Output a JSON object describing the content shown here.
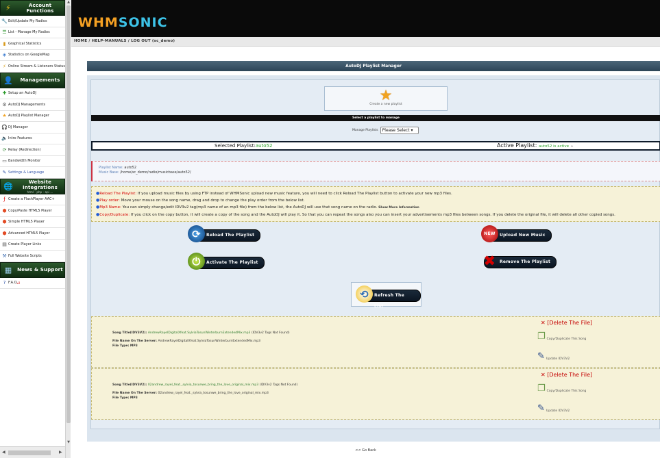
{
  "sidebar": {
    "sections": [
      {
        "title": "Account Functions",
        "icon": "lightning-icon",
        "items": [
          {
            "label": "Edit/Update My Radios",
            "icon": "wrench-icon"
          },
          {
            "label": "List - Manage My Radios",
            "icon": "list-icon"
          },
          {
            "label": "Graphical Statistics",
            "icon": "chart-icon"
          },
          {
            "label": "Statistics on GoogleMap",
            "icon": "map-icon"
          },
          {
            "label": "Online Stream & Listeners Status",
            "icon": "signal-icon"
          }
        ]
      },
      {
        "title": "Managements",
        "icon": "person-icon",
        "items": [
          {
            "label": "Setup an AutoDJ",
            "icon": "plus-icon"
          },
          {
            "label": "AutoDJ Managements",
            "icon": "gear-icon"
          },
          {
            "label": "AutoDJ Playlist Manager",
            "icon": "star-icon"
          },
          {
            "label": "DJ Manager",
            "icon": "headphones-icon"
          },
          {
            "label": "Intro Features",
            "icon": "speaker-icon"
          },
          {
            "label": "Relay (Redirection)",
            "icon": "relay-icon"
          },
          {
            "label": "Bandwidth Monitor",
            "icon": "monitor-icon"
          },
          {
            "label": "Settings & Language",
            "icon": "settings-icon"
          }
        ]
      },
      {
        "title": "Website Integrations",
        "subtitle": "html - php - api ...",
        "icon": "globe-icon",
        "items": [
          {
            "label": "Create a FlashPlayer AAC+",
            "icon": "flash-icon"
          },
          {
            "label": "Copy/Paste HTML5 Player",
            "icon": "html5-icon"
          },
          {
            "label": "Simple HTML5 Player",
            "icon": "html5-icon"
          },
          {
            "label": "Advanced HTML5 Player",
            "icon": "html5-icon"
          },
          {
            "label": "Create Player Links",
            "icon": "link-icon"
          },
          {
            "label": "Full Website Scripts",
            "icon": "script-icon"
          }
        ]
      },
      {
        "title": "News & Support",
        "icon": "newspaper-icon",
        "items": [
          {
            "label": "F.A.Q",
            "badge": "v2",
            "icon": "faq-icon"
          }
        ]
      }
    ]
  },
  "header": {
    "logo_part1": "WHM",
    "logo_part2": "SONIC",
    "breadcrumb": [
      "HOME",
      "HELP-MANUALS",
      "LOG OUT (sc_demo)"
    ]
  },
  "manager": {
    "title": "AutoDJ Playlist Manager",
    "create_label": "Create a new playlist",
    "select_bar": "Select a playlist to manage",
    "manage_label": "Manage Playlists",
    "select_value": "Please Select",
    "selected_label": "Selected Playlist:",
    "selected_value": "auto52",
    "active_label": "Active Playlist:",
    "active_value": "auto52 is active",
    "playlist_name_label": "Playlist Name:",
    "playlist_name": "auto52",
    "music_base_label": "Music Base:",
    "music_base": "/home/sc_demo/radio/musicbase/auto52/"
  },
  "tips": [
    {
      "key": "Reload The Playlist:",
      "text": " If you upload music files by using FTP instead of WHMSonic upload new music feature, you will need to click Reload The Playlist button to activate your new mp3 files.",
      "bold": false
    },
    {
      "key": "Play order:",
      "text": " Move your mouse on the song name, drag and drop to change the play order from the below list.",
      "bold": false
    },
    {
      "key": "Mp3 Name:",
      "text": " You can simply change/edit IDV3v2 tag(mp3 name of an mp3 file) from the below list, the AutoDJ will use that song name on the radio.",
      "extra": "Show More Information",
      "bold": false
    },
    {
      "key": "Copy/Duplicate:",
      "text": " If you click on the copy button, it will create a copy of the song and the AutoDJ will play it. So that you can repeat the songs also you can insert your advertisements mp3 files between songs. If you delete the original file, it will delete all other copied songs.",
      "bold": false
    }
  ],
  "buttons": {
    "reload": "Reload The Playlist",
    "activate": "Activate The Playlist",
    "upload": "Upload New Music",
    "upload_badge": "NEW",
    "remove": "Remove The Playlist",
    "refresh": "Refresh The List"
  },
  "songs": [
    {
      "title_label": "Song Title(IDV3V2):",
      "title": "AndrewRayelDigitalXfeat.SylviaTosunWinterburnExtendedMix.mp3",
      "tag_note": "(IDV3v2 Tags Not Found)",
      "file_label": "File Name On The Server:",
      "file": "AndrewRayelDigitalXfeat.SylviaTosunWinterburnExtendedMix.mp3",
      "type_label": "File Type:",
      "type": "MP3",
      "delete": "[Delete The File]",
      "copy": "Copy/Duplicate This Song",
      "update": "Update IDV3V2"
    },
    {
      "title_label": "Song Title(IDV3V2):",
      "title": "02andrew_rayel_feat._sylvia_tosunwe_bring_the_love_original_mix.mp3",
      "tag_note": "(IDV3v2 Tags Not Found)",
      "file_label": "File Name On The Server:",
      "file": "02andrew_rayel_feat._sylvia_tosunwe_bring_the_love_original_mix.mp3",
      "type_label": "File Type:",
      "type": "MP3",
      "delete": "[Delete The File]",
      "copy": "Copy/Duplicate This Song",
      "update": "Update IDV3V2"
    }
  ],
  "footer": {
    "go_back": "<< Go Back"
  },
  "colors": {
    "active_green": "#2ca32c",
    "tip_red": "#d40000",
    "logo_orange": "#f4a023",
    "logo_blue": "#3dc3e8"
  }
}
